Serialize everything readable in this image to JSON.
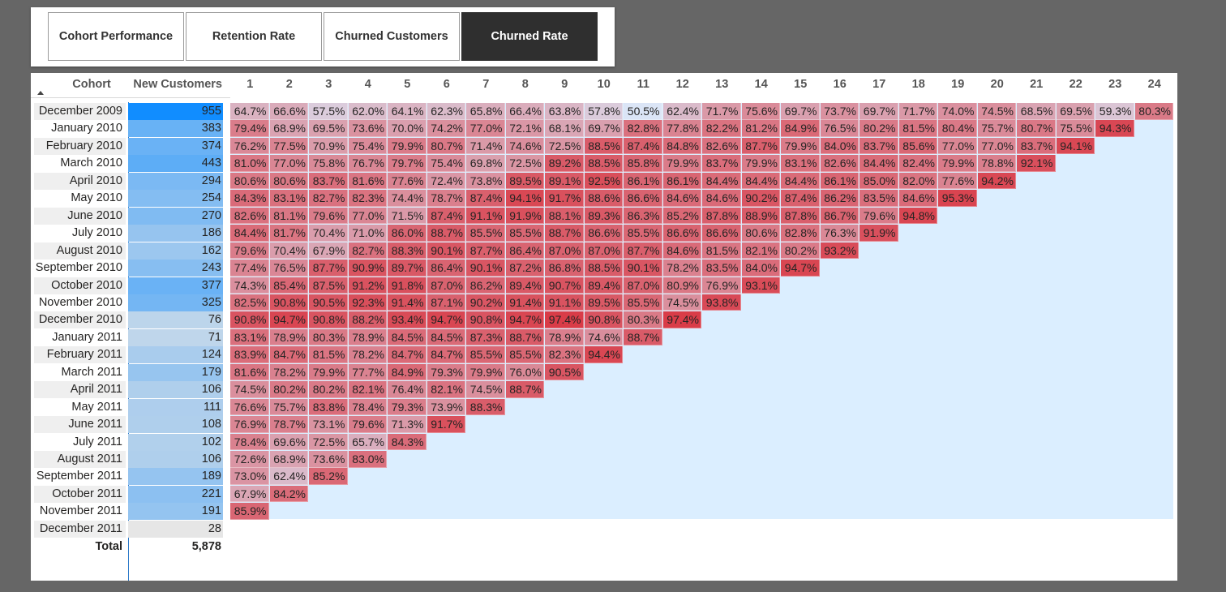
{
  "tabs": [
    {
      "label": "Cohort Performance",
      "active": false
    },
    {
      "label": "Retention Rate",
      "active": false
    },
    {
      "label": "Churned Customers",
      "active": false
    },
    {
      "label": "Churned Rate",
      "active": true
    }
  ],
  "matrix": {
    "headers": {
      "cohort": "Cohort",
      "new_customers": "New Customers",
      "sort_indicator": "sort-ascending-icon"
    },
    "periods": [
      "1",
      "2",
      "3",
      "4",
      "5",
      "6",
      "7",
      "8",
      "9",
      "10",
      "11",
      "12",
      "13",
      "14",
      "15",
      "16",
      "17",
      "18",
      "19",
      "20",
      "21",
      "22",
      "23",
      "24"
    ],
    "colors": {
      "low": "#dbeeff",
      "high": "#d93a46",
      "new_customers_max": "#118dff",
      "new_customers_min": "#e6e6e6"
    },
    "rows": [
      {
        "cohort": "December 2009",
        "new": "955",
        "new_value": 955,
        "rates": [
          "64.7%",
          "66.6%",
          "57.5%",
          "62.0%",
          "64.1%",
          "62.3%",
          "65.8%",
          "66.4%",
          "63.8%",
          "57.8%",
          "50.5%",
          "62.4%",
          "71.7%",
          "75.6%",
          "69.7%",
          "73.7%",
          "69.7%",
          "71.7%",
          "74.0%",
          "74.5%",
          "68.5%",
          "69.5%",
          "59.3%",
          "80.3%"
        ]
      },
      {
        "cohort": "January 2010",
        "new": "383",
        "new_value": 383,
        "rates": [
          "79.4%",
          "68.9%",
          "69.5%",
          "73.6%",
          "70.0%",
          "74.2%",
          "77.0%",
          "72.1%",
          "68.1%",
          "69.7%",
          "82.8%",
          "77.8%",
          "82.2%",
          "81.2%",
          "84.9%",
          "76.5%",
          "80.2%",
          "81.5%",
          "80.4%",
          "75.7%",
          "80.7%",
          "75.5%",
          "94.3%"
        ]
      },
      {
        "cohort": "February 2010",
        "new": "374",
        "new_value": 374,
        "rates": [
          "76.2%",
          "77.5%",
          "70.9%",
          "75.4%",
          "79.9%",
          "80.7%",
          "71.4%",
          "74.6%",
          "72.5%",
          "88.5%",
          "87.4%",
          "84.8%",
          "82.6%",
          "87.7%",
          "79.9%",
          "84.0%",
          "83.7%",
          "85.6%",
          "77.0%",
          "77.0%",
          "83.7%",
          "94.1%"
        ]
      },
      {
        "cohort": "March 2010",
        "new": "443",
        "new_value": 443,
        "rates": [
          "81.0%",
          "77.0%",
          "75.8%",
          "76.7%",
          "79.7%",
          "75.4%",
          "69.8%",
          "72.5%",
          "89.2%",
          "88.5%",
          "85.8%",
          "79.9%",
          "83.7%",
          "79.9%",
          "83.1%",
          "82.6%",
          "84.4%",
          "82.4%",
          "79.9%",
          "78.8%",
          "92.1%"
        ]
      },
      {
        "cohort": "April 2010",
        "new": "294",
        "new_value": 294,
        "rates": [
          "80.6%",
          "80.6%",
          "83.7%",
          "81.6%",
          "77.6%",
          "72.4%",
          "73.8%",
          "89.5%",
          "89.1%",
          "92.5%",
          "86.1%",
          "86.1%",
          "84.4%",
          "84.4%",
          "84.4%",
          "86.1%",
          "85.0%",
          "82.0%",
          "77.6%",
          "94.2%"
        ]
      },
      {
        "cohort": "May 2010",
        "new": "254",
        "new_value": 254,
        "rates": [
          "84.3%",
          "83.1%",
          "82.7%",
          "82.3%",
          "74.4%",
          "78.7%",
          "87.4%",
          "94.1%",
          "91.7%",
          "88.6%",
          "86.6%",
          "84.6%",
          "84.6%",
          "90.2%",
          "87.4%",
          "86.2%",
          "83.5%",
          "84.6%",
          "95.3%"
        ]
      },
      {
        "cohort": "June 2010",
        "new": "270",
        "new_value": 270,
        "rates": [
          "82.6%",
          "81.1%",
          "79.6%",
          "77.0%",
          "71.5%",
          "87.4%",
          "91.1%",
          "91.9%",
          "88.1%",
          "89.3%",
          "86.3%",
          "85.2%",
          "87.8%",
          "88.9%",
          "87.8%",
          "86.7%",
          "79.6%",
          "94.8%"
        ]
      },
      {
        "cohort": "July 2010",
        "new": "186",
        "new_value": 186,
        "rates": [
          "84.4%",
          "81.7%",
          "70.4%",
          "71.0%",
          "86.0%",
          "88.7%",
          "85.5%",
          "85.5%",
          "88.7%",
          "86.6%",
          "85.5%",
          "86.6%",
          "86.6%",
          "80.6%",
          "82.8%",
          "76.3%",
          "91.9%"
        ]
      },
      {
        "cohort": "August 2010",
        "new": "162",
        "new_value": 162,
        "rates": [
          "79.6%",
          "70.4%",
          "67.9%",
          "82.7%",
          "88.3%",
          "90.1%",
          "87.7%",
          "86.4%",
          "87.0%",
          "87.0%",
          "87.7%",
          "84.6%",
          "81.5%",
          "82.1%",
          "80.2%",
          "93.2%"
        ]
      },
      {
        "cohort": "September 2010",
        "new": "243",
        "new_value": 243,
        "rates": [
          "77.4%",
          "76.5%",
          "87.7%",
          "90.9%",
          "89.7%",
          "86.4%",
          "90.1%",
          "87.2%",
          "86.8%",
          "88.5%",
          "90.1%",
          "78.2%",
          "83.5%",
          "84.0%",
          "94.7%"
        ]
      },
      {
        "cohort": "October 2010",
        "new": "377",
        "new_value": 377,
        "rates": [
          "74.3%",
          "85.4%",
          "87.5%",
          "91.2%",
          "91.8%",
          "87.0%",
          "86.2%",
          "89.4%",
          "90.7%",
          "89.4%",
          "87.0%",
          "80.9%",
          "76.9%",
          "93.1%"
        ]
      },
      {
        "cohort": "November 2010",
        "new": "325",
        "new_value": 325,
        "rates": [
          "82.5%",
          "90.8%",
          "90.5%",
          "92.3%",
          "91.4%",
          "87.1%",
          "90.2%",
          "91.4%",
          "91.1%",
          "89.5%",
          "85.5%",
          "74.5%",
          "93.8%"
        ]
      },
      {
        "cohort": "December 2010",
        "new": "76",
        "new_value": 76,
        "rates": [
          "90.8%",
          "94.7%",
          "90.8%",
          "88.2%",
          "93.4%",
          "94.7%",
          "90.8%",
          "94.7%",
          "97.4%",
          "90.8%",
          "80.3%",
          "97.4%"
        ]
      },
      {
        "cohort": "January 2011",
        "new": "71",
        "new_value": 71,
        "rates": [
          "83.1%",
          "78.9%",
          "80.3%",
          "78.9%",
          "84.5%",
          "84.5%",
          "87.3%",
          "88.7%",
          "78.9%",
          "74.6%",
          "88.7%"
        ]
      },
      {
        "cohort": "February 2011",
        "new": "124",
        "new_value": 124,
        "rates": [
          "83.9%",
          "84.7%",
          "81.5%",
          "78.2%",
          "84.7%",
          "84.7%",
          "85.5%",
          "85.5%",
          "82.3%",
          "94.4%"
        ]
      },
      {
        "cohort": "March 2011",
        "new": "179",
        "new_value": 179,
        "rates": [
          "81.6%",
          "78.2%",
          "79.9%",
          "77.7%",
          "84.9%",
          "79.3%",
          "79.9%",
          "76.0%",
          "90.5%"
        ]
      },
      {
        "cohort": "April 2011",
        "new": "106",
        "new_value": 106,
        "rates": [
          "74.5%",
          "80.2%",
          "80.2%",
          "82.1%",
          "76.4%",
          "82.1%",
          "74.5%",
          "88.7%"
        ]
      },
      {
        "cohort": "May 2011",
        "new": "111",
        "new_value": 111,
        "rates": [
          "76.6%",
          "75.7%",
          "83.8%",
          "78.4%",
          "79.3%",
          "73.9%",
          "88.3%"
        ]
      },
      {
        "cohort": "June 2011",
        "new": "108",
        "new_value": 108,
        "rates": [
          "76.9%",
          "78.7%",
          "73.1%",
          "79.6%",
          "71.3%",
          "91.7%"
        ]
      },
      {
        "cohort": "July 2011",
        "new": "102",
        "new_value": 102,
        "rates": [
          "78.4%",
          "69.6%",
          "72.5%",
          "65.7%",
          "84.3%"
        ]
      },
      {
        "cohort": "August 2011",
        "new": "106",
        "new_value": 106,
        "rates": [
          "72.6%",
          "68.9%",
          "73.6%",
          "83.0%"
        ]
      },
      {
        "cohort": "September 2011",
        "new": "189",
        "new_value": 189,
        "rates": [
          "73.0%",
          "62.4%",
          "85.2%"
        ]
      },
      {
        "cohort": "October 2011",
        "new": "221",
        "new_value": 221,
        "rates": [
          "67.9%",
          "84.2%"
        ]
      },
      {
        "cohort": "November 2011",
        "new": "191",
        "new_value": 191,
        "rates": [
          "85.9%"
        ]
      },
      {
        "cohort": "December 2011",
        "new": "28",
        "new_value": 28,
        "rates": []
      }
    ],
    "total": {
      "label": "Total",
      "value": "5,878"
    }
  }
}
